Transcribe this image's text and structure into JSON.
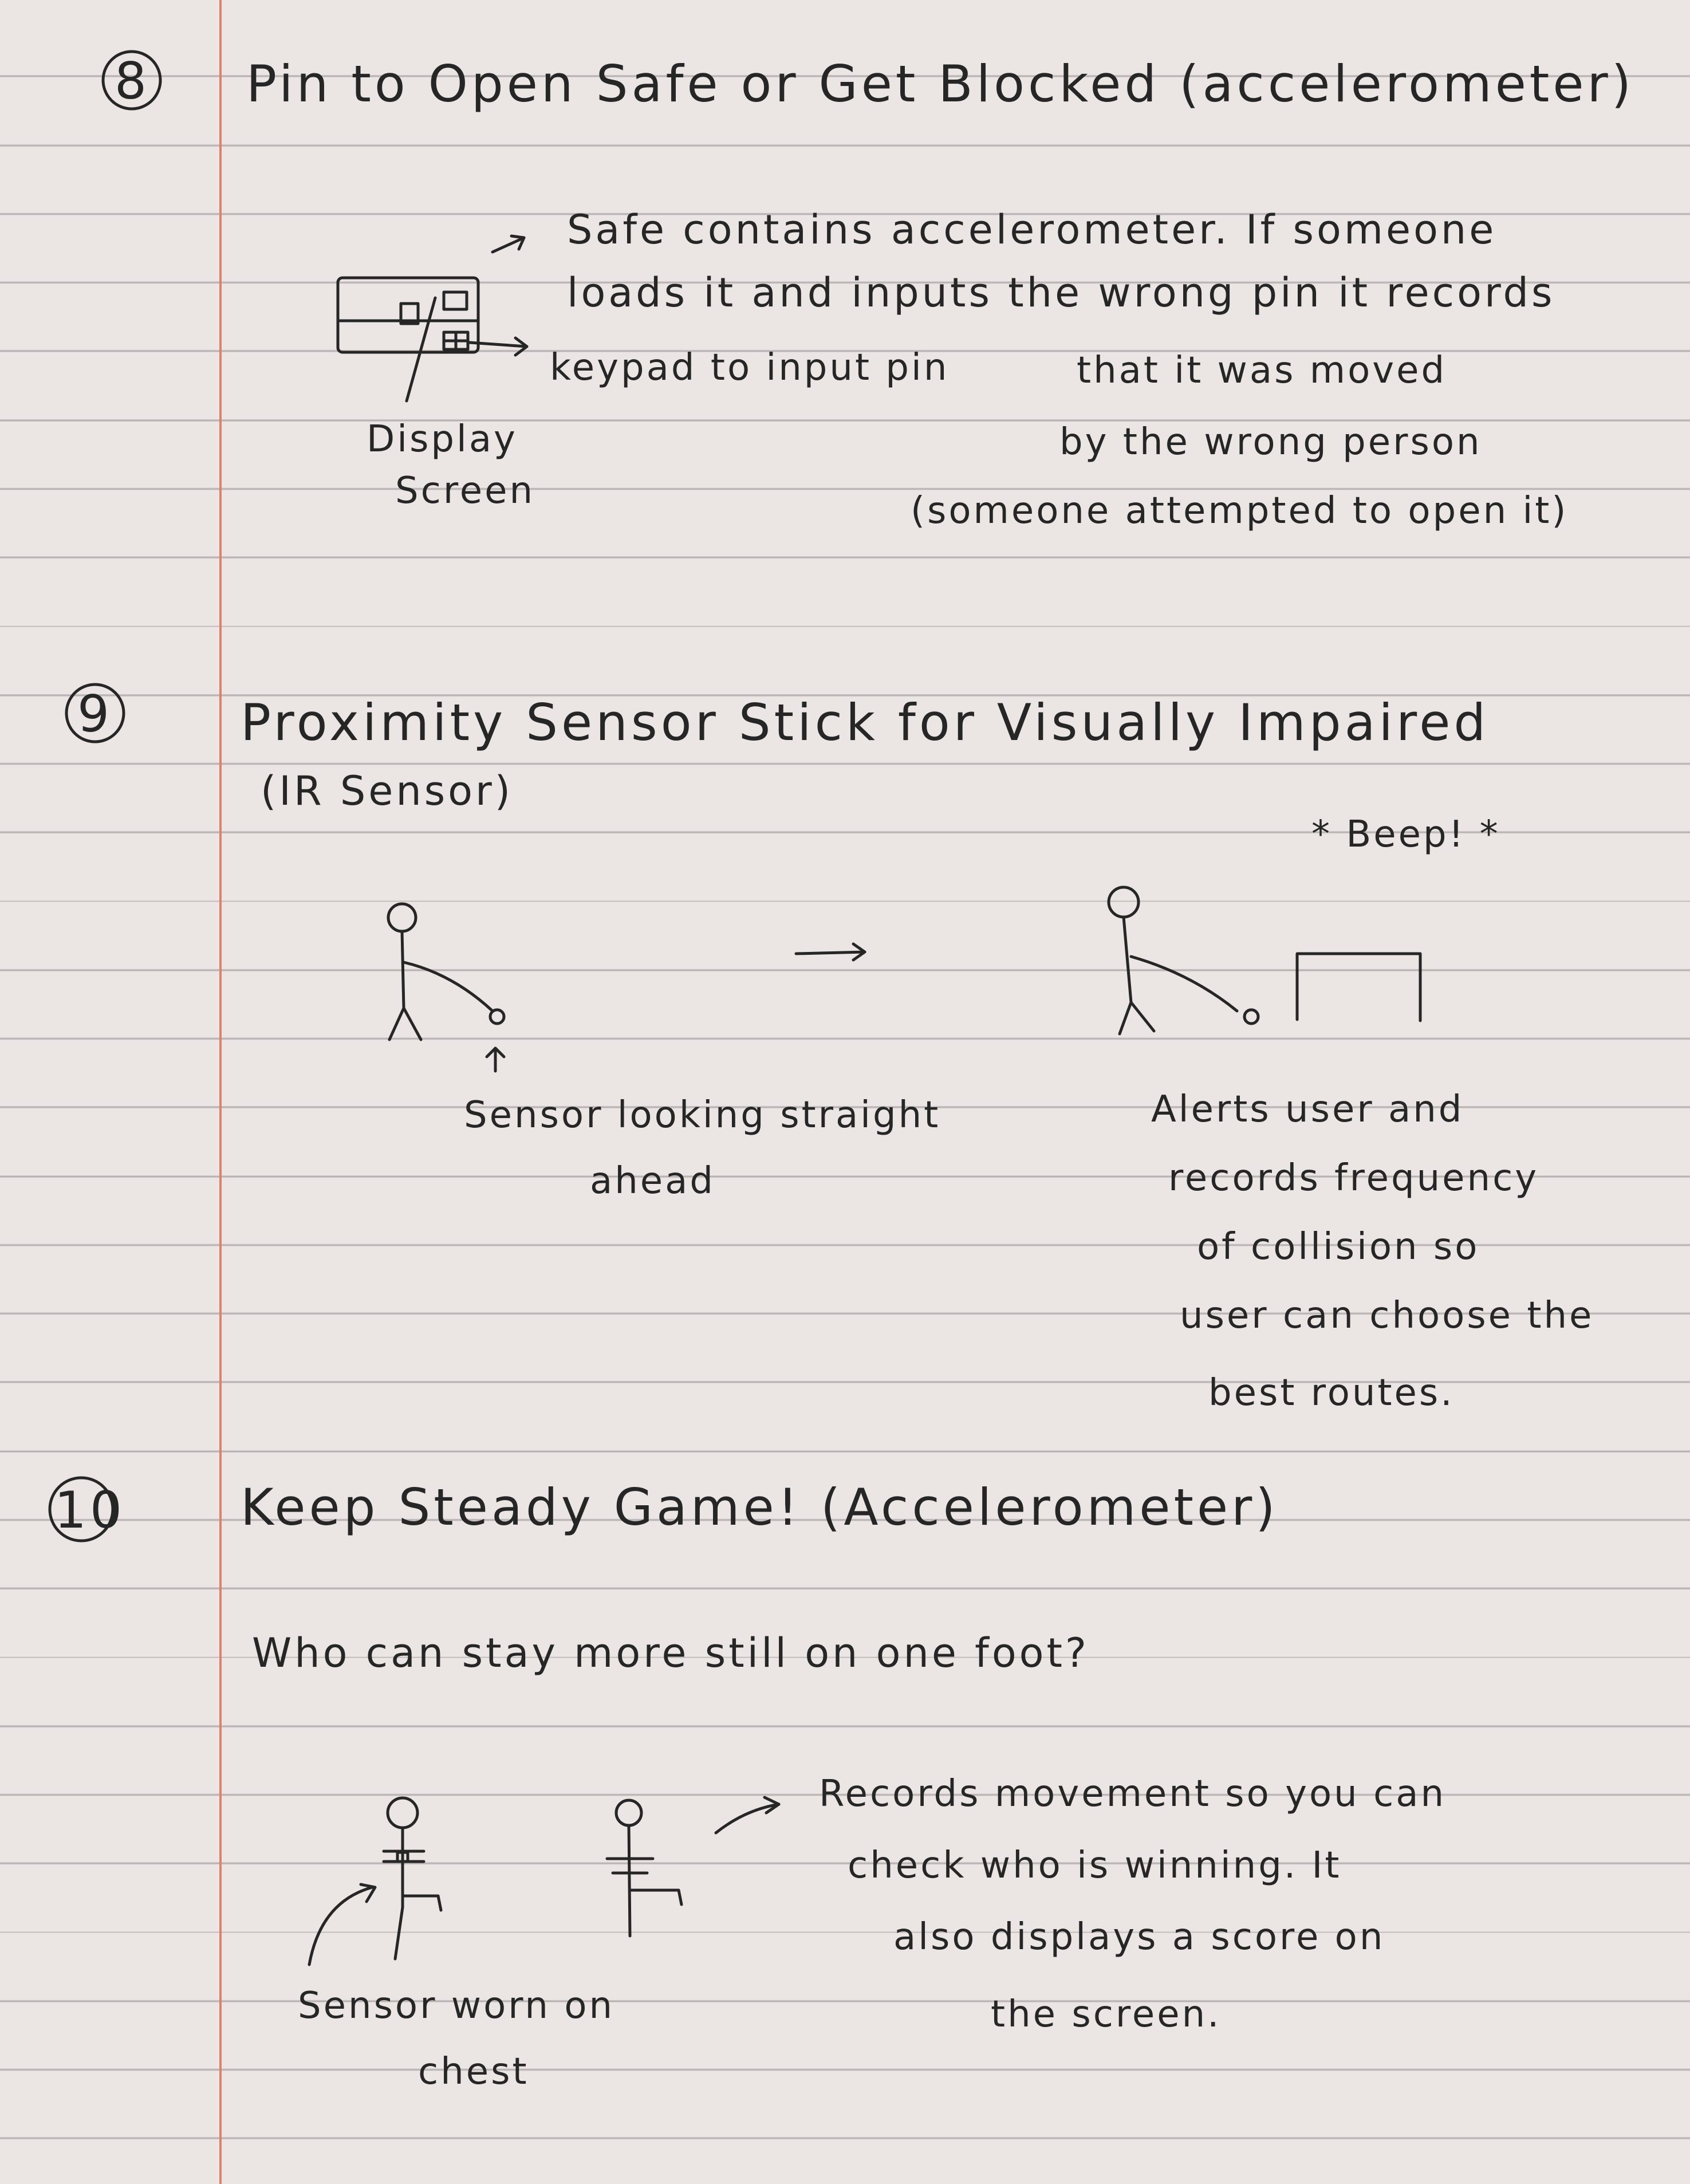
{
  "sections": [
    {
      "number": "8",
      "title": "Pin to Open Safe or Get Blocked (accelerometer)",
      "note_lines": [
        "Safe contains accelerometer. If someone",
        "loads it and inputs the wrong pin it records",
        "that it was moved",
        "by the wrong person",
        "(someone attempted to open it)"
      ],
      "keypad_label": "keypad to input pin",
      "display_label_line1": "Display",
      "display_label_line2": "Screen"
    },
    {
      "number": "9",
      "title": "Proximity Sensor Stick for Visually Impaired",
      "subtitle": "(IR Sensor)",
      "beep": "* Beep! *",
      "left_caption_line1": "Sensor looking straight",
      "left_caption_line2": "ahead",
      "right_caption_lines": [
        "Alerts user and",
        "records frequency",
        "of collision so",
        "user can choose the",
        "best routes."
      ]
    },
    {
      "number": "10",
      "title": "Keep Steady Game! (Accelerometer)",
      "question": "Who can stay more still on one foot?",
      "note_lines": [
        "Records movement so you can",
        "check who is winning. It",
        "also displays a score on",
        "the screen."
      ],
      "sensor_caption_line1": "Sensor worn on",
      "sensor_caption_line2": "chest"
    }
  ],
  "colors": {
    "paper": "#ebe6e4",
    "ruled_line": "#b9b3b3",
    "margin_line": "#e07f6e",
    "ink": "#262626"
  }
}
